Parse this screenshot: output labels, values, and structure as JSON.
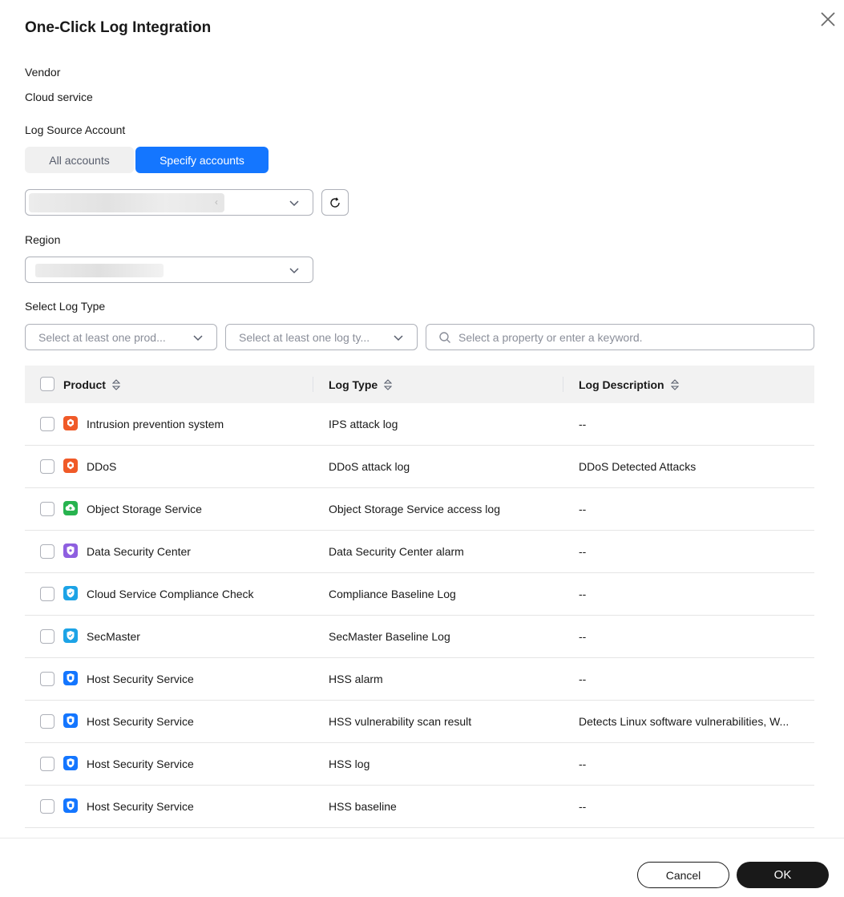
{
  "dialog": {
    "title": "One-Click Log Integration"
  },
  "vendor": {
    "label": "Vendor",
    "value": "Cloud service"
  },
  "log_source_account": {
    "label": "Log Source Account",
    "options": [
      "All accounts",
      "Specify accounts"
    ],
    "selected": "Specify accounts"
  },
  "region": {
    "label": "Region"
  },
  "select_log_type": {
    "label": "Select Log Type",
    "product_filter_placeholder": "Select at least one prod...",
    "logtype_filter_placeholder": "Select at least one log ty...",
    "search_placeholder": "Select a property or enter a keyword."
  },
  "table": {
    "columns": [
      "Product",
      "Log Type",
      "Log Description"
    ],
    "rows": [
      {
        "product": "Intrusion prevention system",
        "icon": "ips-icon",
        "icon_color": "#f05a28",
        "log_type": "IPS attack log",
        "description": "--"
      },
      {
        "product": "DDoS",
        "icon": "ddos-icon",
        "icon_color": "#f05a28",
        "log_type": "DDoS attack log",
        "description": "DDoS Detected Attacks"
      },
      {
        "product": "Object Storage Service",
        "icon": "cloud-upload-icon",
        "icon_color": "#27b34f",
        "log_type": "Object Storage Service access log",
        "description": "--"
      },
      {
        "product": "Data Security Center",
        "icon": "shield-icon",
        "icon_color": "#8e5fe0",
        "log_type": "Data Security Center alarm",
        "description": "--"
      },
      {
        "product": "Cloud Service Compliance Check",
        "icon": "compliance-shield-icon",
        "icon_color": "#1ca3e6",
        "log_type": "Compliance Baseline Log",
        "description": "--"
      },
      {
        "product": "SecMaster",
        "icon": "secmaster-shield-icon",
        "icon_color": "#1ca3e6",
        "log_type": "SecMaster Baseline Log",
        "description": "--"
      },
      {
        "product": "Host Security Service",
        "icon": "host-security-icon",
        "icon_color": "#1476ff",
        "log_type": "HSS alarm",
        "description": "--"
      },
      {
        "product": "Host Security Service",
        "icon": "host-security-icon",
        "icon_color": "#1476ff",
        "log_type": "HSS vulnerability scan result",
        "description": "Detects Linux software vulnerabilities, W..."
      },
      {
        "product": "Host Security Service",
        "icon": "host-security-icon",
        "icon_color": "#1476ff",
        "log_type": "HSS log",
        "description": "--"
      },
      {
        "product": "Host Security Service",
        "icon": "host-security-icon",
        "icon_color": "#1476ff",
        "log_type": "HSS baseline",
        "description": "--"
      }
    ]
  },
  "footer": {
    "cancel_label": "Cancel",
    "ok_label": "OK"
  },
  "colors": {
    "accent": "#1476ff",
    "primary_button": "#191919"
  }
}
